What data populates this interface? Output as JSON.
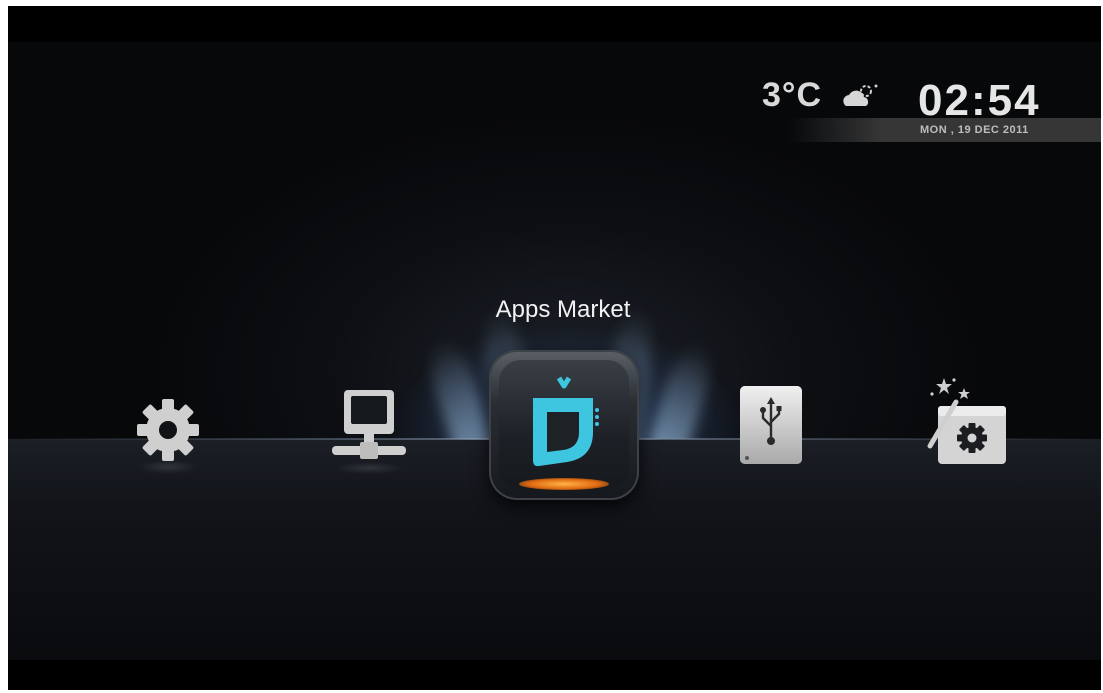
{
  "status": {
    "temperature": "3°C",
    "weather_icon": "cloud-sun-icon",
    "time": "02:54",
    "date": "MON , 19 DEC 2011"
  },
  "menu": {
    "selected_label": "Apps Market",
    "items": [
      {
        "id": "settings",
        "icon": "gear-icon"
      },
      {
        "id": "network",
        "icon": "network-computer-icon"
      },
      {
        "id": "apps-market",
        "icon": "apps-market-icon",
        "selected": true
      },
      {
        "id": "usb",
        "icon": "usb-drive-icon"
      },
      {
        "id": "setup-wizard",
        "icon": "setup-wizard-icon"
      }
    ]
  },
  "colors": {
    "accent_cyan": "#3ec6e0",
    "accent_orange": "#f08a24",
    "text_light": "#e6e6e6",
    "background": "#0a0b0e"
  }
}
